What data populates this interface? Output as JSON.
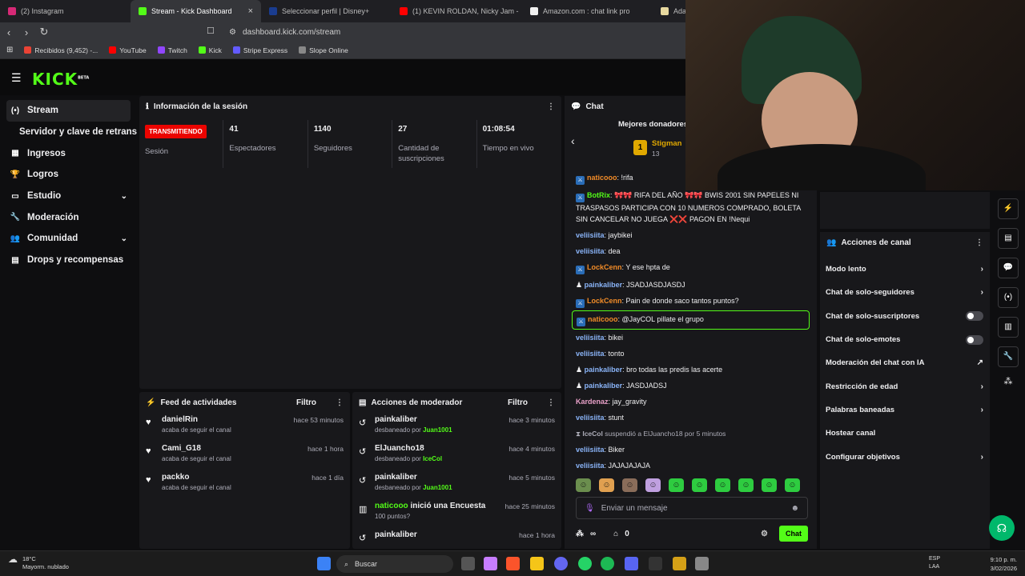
{
  "browser": {
    "tabs": [
      {
        "label": "(2) Instagram",
        "color": "#d62976",
        "active": false
      },
      {
        "label": "Stream - Kick Dashboard",
        "color": "#53fc18",
        "active": true
      },
      {
        "label": "Seleccionar perfil | Disney+",
        "color": "#1a3c8f",
        "active": false
      },
      {
        "label": "(1) KEVIN ROLDAN, Nicky Jam -",
        "color": "#ff0000",
        "active": false
      },
      {
        "label": "Amazon.com : chat link pro",
        "color": "#f0f0f0",
        "active": false
      },
      {
        "label": "Adap",
        "color": "#e8d9a0",
        "active": false
      }
    ],
    "url": "dashboard.kick.com/stream",
    "bookmarks": [
      {
        "label": "Recibidos (9,452) -...",
        "color": "#ea4335"
      },
      {
        "label": "YouTube",
        "color": "#ff0000"
      },
      {
        "label": "Twitch",
        "color": "#9146ff"
      },
      {
        "label": "Kick",
        "color": "#53fc18"
      },
      {
        "label": "Stripe Express",
        "color": "#635bff"
      },
      {
        "label": "Slope Online",
        "color": "#888888"
      }
    ]
  },
  "kick": {
    "logo": "KICK",
    "beta": "BETA"
  },
  "sidebar": {
    "items": [
      {
        "label": "Stream",
        "icon": "stream-icon",
        "glyph": "(•)"
      },
      {
        "label": "Servidor y clave de retransmisión"
      },
      {
        "label": "Ingresos",
        "icon": "revenue-icon",
        "glyph": "▦"
      },
      {
        "label": "Logros",
        "icon": "trophy-icon",
        "glyph": "🏆"
      },
      {
        "label": "Estudio",
        "icon": "studio-icon",
        "glyph": "▭"
      },
      {
        "label": "Moderación",
        "icon": "wrench-icon",
        "glyph": "🔧"
      },
      {
        "label": "Comunidad",
        "icon": "community-icon",
        "glyph": "👥"
      },
      {
        "label": "Drops y recompensas",
        "icon": "drops-icon",
        "glyph": "▤"
      }
    ]
  },
  "session": {
    "title": "Información de la sesión",
    "live_badge": "TRANSMITIENDO",
    "live_label": "Sesión",
    "stats": [
      {
        "value": "41",
        "label": "Espectadores"
      },
      {
        "value": "1140",
        "label": "Seguidores"
      },
      {
        "value": "27",
        "label": "Cantidad de suscripciones"
      },
      {
        "value": "01:08:54",
        "label": "Tiempo en vivo"
      }
    ]
  },
  "feed": {
    "title": "Feed de actividades",
    "filter": "Filtro",
    "rows": [
      {
        "name": "danielRin",
        "sub": "acaba de seguir el canal",
        "time": "hace 53 minutos"
      },
      {
        "name": "Cami_G18",
        "sub": "acaba de seguir el canal",
        "time": "hace 1 hora"
      },
      {
        "name": "packko",
        "sub": "acaba de seguir el canal",
        "time": "hace 1 día"
      }
    ]
  },
  "modactions": {
    "title": "Acciones de moderador",
    "filter": "Filtro",
    "rows": [
      {
        "name": "painkaliber",
        "sub": "desbaneado por",
        "by": "Juan1001",
        "time": "hace 3 minutos"
      },
      {
        "name": "ElJuancho18",
        "sub": "desbaneado por",
        "by": "IceCol",
        "time": "hace 4 minutos"
      },
      {
        "name": "painkaliber",
        "sub": "desbaneado por",
        "by": "Juan1001",
        "time": "hace 5 minutos"
      },
      {
        "name": "naticooo",
        "action": "inició una Encuesta",
        "sub": "100 puntos?",
        "time": "hace 25 minutos"
      },
      {
        "name": "painkaliber",
        "sub": "",
        "time": "hace 1 hora"
      }
    ]
  },
  "chat": {
    "title": "Chat",
    "top_donors": "Mejores donadores",
    "donor": {
      "rank": "1",
      "name": "Stigman",
      "amount": "13"
    },
    "messages": [
      {
        "user": "naticooo",
        "color": "#f28c28",
        "text": ": !rifa"
      },
      {
        "user": "BotRix",
        "color": "#53fc18",
        "text": ": 🎀🎀 RIFA DEL AÑO 🎀🎀 BWIS 2001 SIN PAPELES NI TRASPASOS PARTICIPA CON 10 NUMEROS COMPRADO, BOLETA SIN CANCELAR NO JUEGA ❌❌ PAGON EN !Nequi"
      },
      {
        "user": "veliisiita",
        "color": "#8ab4f8",
        "text": ": jaybikei"
      },
      {
        "user": "veliisiita",
        "color": "#8ab4f8",
        "text": ": dea"
      },
      {
        "user": "LockCenn",
        "color": "#f28c28",
        "text": ": Y ese hpta de"
      },
      {
        "user": "painkaliber",
        "color": "#8ab4f8",
        "text": ": JSADJASDJASDJ"
      },
      {
        "user": "LockCenn",
        "color": "#f28c28",
        "text": ": Pain de donde saco tantos puntos?"
      },
      {
        "user": "naticooo",
        "color": "#f28c28",
        "text": ": @JayCOL pillate el grupo",
        "highlight": true
      },
      {
        "user": "veliisiita",
        "color": "#8ab4f8",
        "text": ": bikei"
      },
      {
        "user": "veliisiita",
        "color": "#8ab4f8",
        "text": ": tonto"
      },
      {
        "user": "painkaliber",
        "color": "#8ab4f8",
        "text": ": bro todas las predis las acerte"
      },
      {
        "user": "painkaliber",
        "color": "#8ab4f8",
        "text": ": JASDJADSJ"
      },
      {
        "user": "Kardenaz",
        "color": "#e8a0c8",
        "text": ": jay_gravity"
      },
      {
        "user": "veliisiita",
        "color": "#8ab4f8",
        "text": ": stunt"
      },
      {
        "user": "IceCol",
        "color": "#adadb8",
        "text": " suspendió a ElJuancho18 por 5 minutos",
        "system": true
      },
      {
        "user": "veliisiita",
        "color": "#8ab4f8",
        "text": ": Biker"
      },
      {
        "user": "veliisiita",
        "color": "#8ab4f8",
        "text": ": JAJAJAJAJA"
      }
    ],
    "input_placeholder": "Enviar un mensaje",
    "points": "∞",
    "store_count": "0",
    "send_label": "Chat"
  },
  "channel_actions": {
    "title": "Acciones de canal",
    "rows": [
      {
        "label": "Modo lento",
        "kind": "chevron"
      },
      {
        "label": "Chat de solo-seguidores",
        "kind": "chevron"
      },
      {
        "label": "Chat de solo-suscriptores",
        "kind": "toggle"
      },
      {
        "label": "Chat de solo-emotes",
        "kind": "toggle"
      },
      {
        "label": "Moderación del chat con IA",
        "kind": "external"
      },
      {
        "label": "Restricción de edad",
        "kind": "chevron"
      },
      {
        "label": "Palabras baneadas",
        "kind": "chevron"
      },
      {
        "label": "Hostear canal",
        "kind": "none"
      },
      {
        "label": "Configurar objetivos",
        "kind": "chevron"
      }
    ]
  },
  "taskbar": {
    "temp": "18°C",
    "weather": "Mayorm. nublado",
    "search": "Buscar",
    "lang1": "ESP",
    "lang2": "LAA",
    "time": "9:10 p. m.",
    "date": "3/02/2026"
  }
}
